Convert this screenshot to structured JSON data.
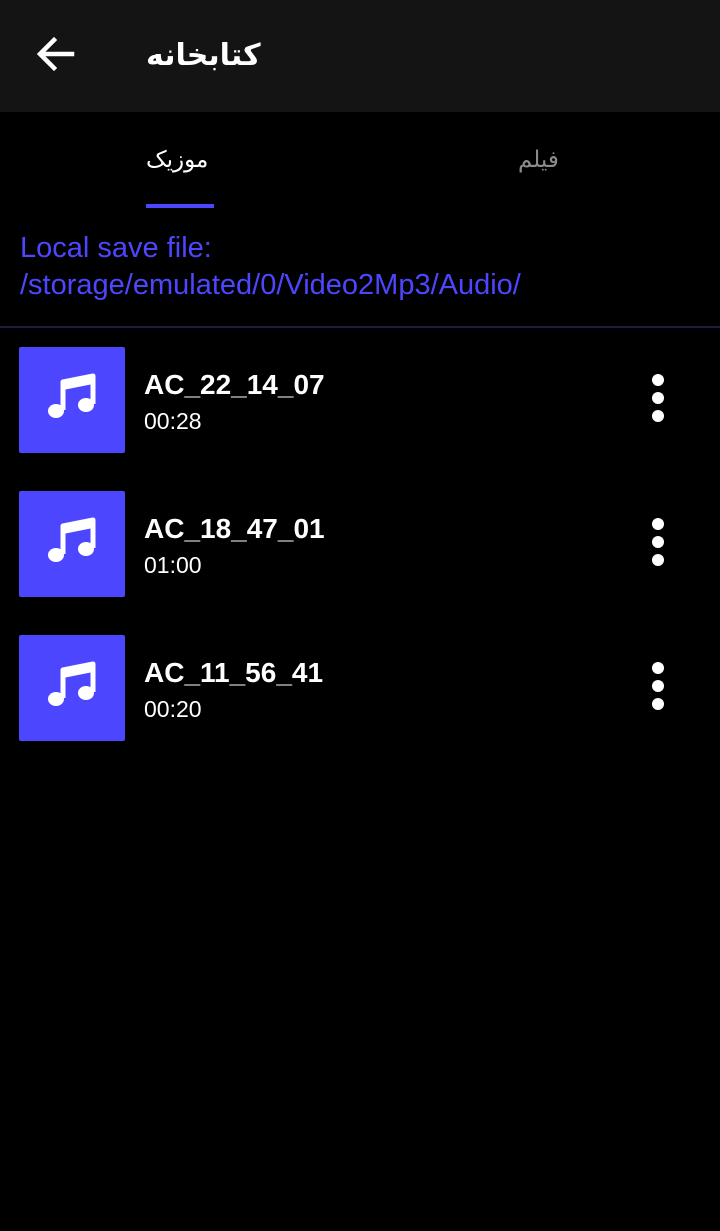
{
  "appbar": {
    "title": "کتابخانه",
    "back_icon": "arrow-left-icon"
  },
  "tabs": [
    {
      "label": "موزیک",
      "selected": true
    },
    {
      "label": "فیلم",
      "selected": false
    }
  ],
  "save_path": {
    "text": "Local save file: /storage/emulated/0/Video2Mp3/Audio/"
  },
  "colors": {
    "accent": "#4d46ff",
    "background": "#000000",
    "appbar": "#141414",
    "tab_inactive": "#8c8c8c"
  },
  "tracks": [
    {
      "title": "AC_22_14_07",
      "duration": "00:28",
      "icon": "music-note-icon",
      "menu_icon": "more-vertical-icon"
    },
    {
      "title": "AC_18_47_01",
      "duration": "01:00",
      "icon": "music-note-icon",
      "menu_icon": "more-vertical-icon"
    },
    {
      "title": "AC_11_56_41",
      "duration": "00:20",
      "icon": "music-note-icon",
      "menu_icon": "more-vertical-icon"
    }
  ]
}
